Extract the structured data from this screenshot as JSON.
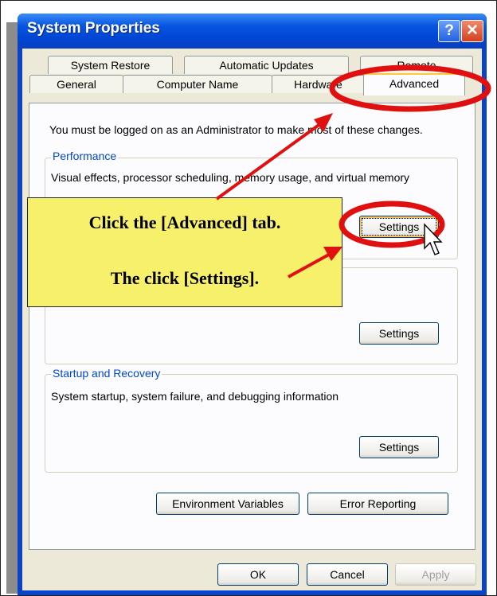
{
  "window": {
    "title": "System Properties",
    "help_glyph": "?",
    "close_glyph": "✕"
  },
  "tabs": {
    "row1": [
      "System Restore",
      "Automatic Updates",
      "Remote"
    ],
    "row2": [
      "General",
      "Computer Name",
      "Hardware",
      "Advanced"
    ],
    "active": "Advanced"
  },
  "advanced": {
    "note": "You must be logged on as an Administrator to make most of these changes.",
    "performance": {
      "title": "Performance",
      "description": "Visual effects, processor scheduling, memory usage, and virtual memory",
      "settings_label": "Settings"
    },
    "user_profiles": {
      "settings_label": "Settings"
    },
    "startup_recovery": {
      "title": "Startup and Recovery",
      "description": "System startup, system failure, and debugging information",
      "settings_label": "Settings"
    },
    "environment_variables_label": "Environment Variables",
    "error_reporting_label": "Error Reporting"
  },
  "footer": {
    "ok_label": "OK",
    "cancel_label": "Cancel",
    "apply_label": "Apply"
  },
  "annotation": {
    "line1": "Click the [Advanced] tab.",
    "line2": "The click [Settings].",
    "highlight_color": "#e01010",
    "callout_color": "#f6f06a"
  }
}
